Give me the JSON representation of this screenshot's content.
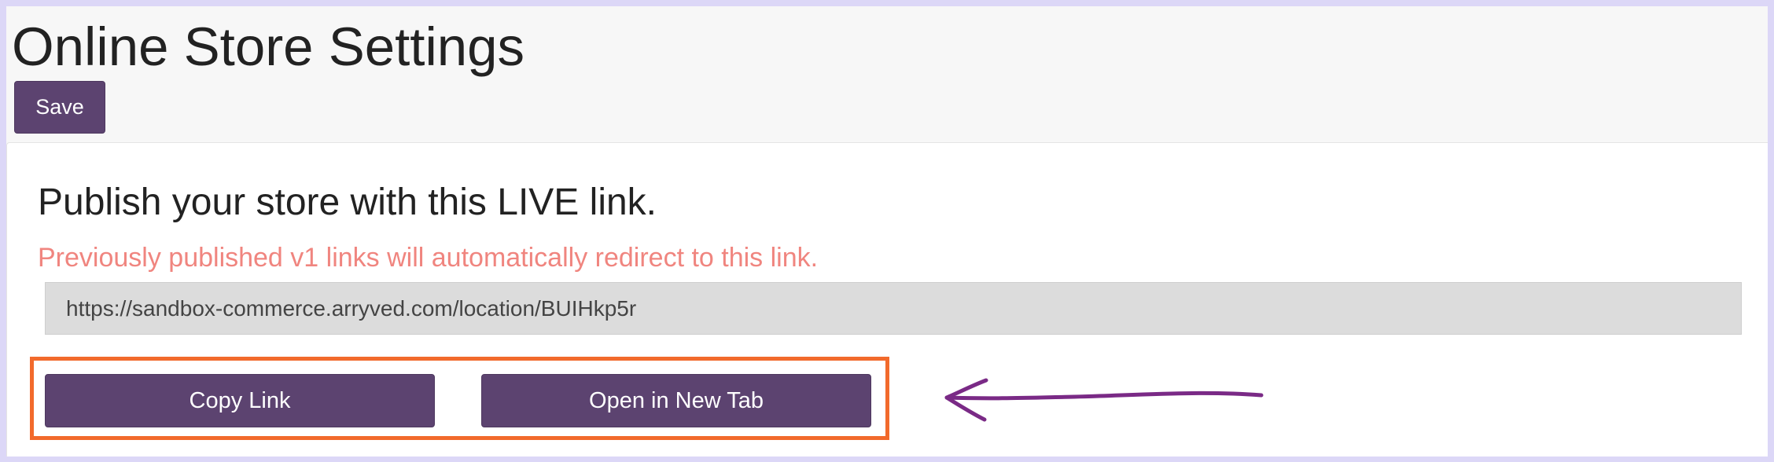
{
  "page": {
    "title": "Online Store Settings"
  },
  "toolbar": {
    "save_label": "Save"
  },
  "publish": {
    "heading": "Publish your store with this LIVE link.",
    "note": "Previously published v1 links will automatically redirect to this link.",
    "link_value": "https://sandbox-commerce.arryved.com/location/BUIHkp5r",
    "copy_label": "Copy Link",
    "open_label": "Open in New Tab"
  },
  "colors": {
    "button": "#5c4370",
    "note": "#f0857f",
    "highlight": "#f26a2c",
    "arrow": "#7a2a86"
  }
}
